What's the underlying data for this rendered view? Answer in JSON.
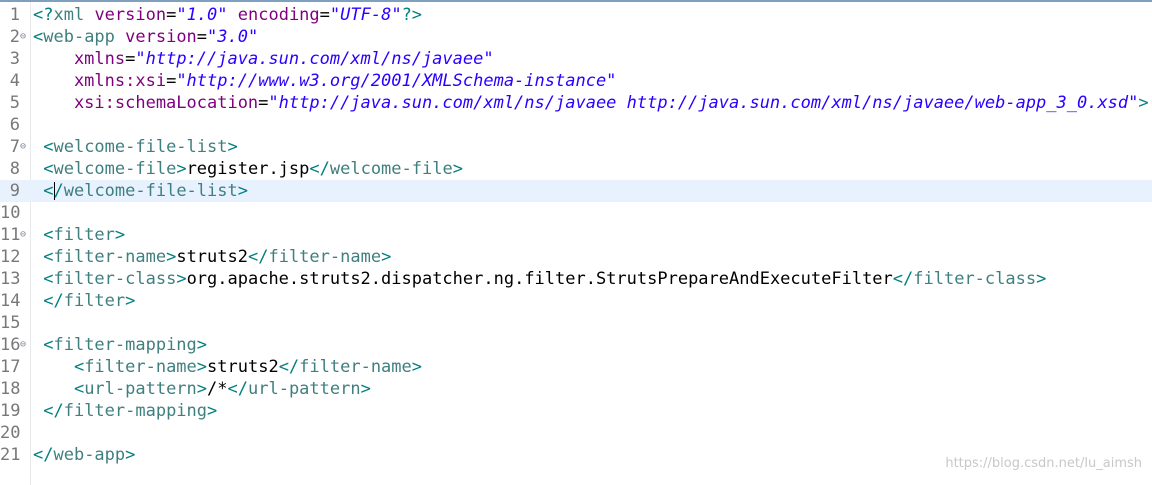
{
  "editor": {
    "lines": [
      {
        "n": "1",
        "fold": false,
        "current": false,
        "tokens": [
          {
            "t": "<?",
            "c": "decl"
          },
          {
            "t": "xml ",
            "c": "tag"
          },
          {
            "t": "version",
            "c": "attr"
          },
          {
            "t": "=",
            "c": "text"
          },
          {
            "t": "\"1.0\"",
            "c": "val"
          },
          {
            "t": " encoding",
            "c": "attr"
          },
          {
            "t": "=",
            "c": "text"
          },
          {
            "t": "\"UTF-8\"",
            "c": "val"
          },
          {
            "t": "?>",
            "c": "decl"
          }
        ]
      },
      {
        "n": "2",
        "fold": true,
        "current": false,
        "tokens": [
          {
            "t": "<",
            "c": "bracket"
          },
          {
            "t": "web-app",
            "c": "tag"
          },
          {
            "t": " version",
            "c": "attr"
          },
          {
            "t": "=",
            "c": "text"
          },
          {
            "t": "\"3.0\"",
            "c": "val"
          }
        ]
      },
      {
        "n": "3",
        "fold": false,
        "current": false,
        "tokens": [
          {
            "t": "    xmlns",
            "c": "attr"
          },
          {
            "t": "=",
            "c": "text"
          },
          {
            "t": "\"http://java.sun.com/xml/ns/javaee\"",
            "c": "val"
          }
        ]
      },
      {
        "n": "4",
        "fold": false,
        "current": false,
        "tokens": [
          {
            "t": "    xmlns:xsi",
            "c": "attr"
          },
          {
            "t": "=",
            "c": "text"
          },
          {
            "t": "\"http://www.w3.org/2001/XMLSchema-instance\"",
            "c": "val"
          }
        ]
      },
      {
        "n": "5",
        "fold": false,
        "current": false,
        "tokens": [
          {
            "t": "    xsi:schemaLocation",
            "c": "attr"
          },
          {
            "t": "=",
            "c": "text"
          },
          {
            "t": "\"http://java.sun.com/xml/ns/javaee http://java.sun.com/xml/ns/javaee/web-app_3_0.xsd\"",
            "c": "val"
          },
          {
            "t": ">",
            "c": "bracket"
          }
        ]
      },
      {
        "n": "6",
        "fold": false,
        "current": false,
        "tokens": []
      },
      {
        "n": "7",
        "fold": true,
        "current": false,
        "tokens": [
          {
            "t": " <",
            "c": "bracket"
          },
          {
            "t": "welcome-file-list",
            "c": "tag"
          },
          {
            "t": ">",
            "c": "bracket"
          }
        ]
      },
      {
        "n": "8",
        "fold": false,
        "current": false,
        "tokens": [
          {
            "t": " <",
            "c": "bracket"
          },
          {
            "t": "welcome-file",
            "c": "tag"
          },
          {
            "t": ">",
            "c": "bracket"
          },
          {
            "t": "register.jsp",
            "c": "text"
          },
          {
            "t": "</",
            "c": "bracket"
          },
          {
            "t": "welcome-file",
            "c": "tag"
          },
          {
            "t": ">",
            "c": "bracket"
          }
        ]
      },
      {
        "n": "9",
        "fold": false,
        "current": true,
        "tokens": [
          {
            "t": " <",
            "c": "bracket"
          },
          {
            "t": "CARET",
            "c": "caret"
          },
          {
            "t": "/",
            "c": "bracket"
          },
          {
            "t": "welcome-file-list",
            "c": "tag"
          },
          {
            "t": ">",
            "c": "bracket"
          }
        ]
      },
      {
        "n": "10",
        "fold": false,
        "current": false,
        "tokens": []
      },
      {
        "n": "11",
        "fold": true,
        "current": false,
        "tokens": [
          {
            "t": " <",
            "c": "bracket"
          },
          {
            "t": "filter",
            "c": "tag"
          },
          {
            "t": ">",
            "c": "bracket"
          }
        ]
      },
      {
        "n": "12",
        "fold": false,
        "current": false,
        "tokens": [
          {
            "t": " <",
            "c": "bracket"
          },
          {
            "t": "filter-name",
            "c": "tag"
          },
          {
            "t": ">",
            "c": "bracket"
          },
          {
            "t": "struts2",
            "c": "text"
          },
          {
            "t": "</",
            "c": "bracket"
          },
          {
            "t": "filter-name",
            "c": "tag"
          },
          {
            "t": ">",
            "c": "bracket"
          }
        ]
      },
      {
        "n": "13",
        "fold": false,
        "current": false,
        "tokens": [
          {
            "t": " <",
            "c": "bracket"
          },
          {
            "t": "filter-class",
            "c": "tag"
          },
          {
            "t": ">",
            "c": "bracket"
          },
          {
            "t": "org.apache.struts2.dispatcher.ng.filter.StrutsPrepareAndExecuteFilter",
            "c": "text"
          },
          {
            "t": "</",
            "c": "bracket"
          },
          {
            "t": "filter-class",
            "c": "tag"
          },
          {
            "t": ">",
            "c": "bracket"
          }
        ]
      },
      {
        "n": "14",
        "fold": false,
        "current": false,
        "tokens": [
          {
            "t": " </",
            "c": "bracket"
          },
          {
            "t": "filter",
            "c": "tag"
          },
          {
            "t": ">",
            "c": "bracket"
          }
        ]
      },
      {
        "n": "15",
        "fold": false,
        "current": false,
        "tokens": []
      },
      {
        "n": "16",
        "fold": true,
        "current": false,
        "tokens": [
          {
            "t": " <",
            "c": "bracket"
          },
          {
            "t": "filter-mapping",
            "c": "tag"
          },
          {
            "t": ">",
            "c": "bracket"
          }
        ]
      },
      {
        "n": "17",
        "fold": false,
        "current": false,
        "tokens": [
          {
            "t": "    <",
            "c": "bracket"
          },
          {
            "t": "filter-name",
            "c": "tag"
          },
          {
            "t": ">",
            "c": "bracket"
          },
          {
            "t": "struts2",
            "c": "text"
          },
          {
            "t": "</",
            "c": "bracket"
          },
          {
            "t": "filter-name",
            "c": "tag"
          },
          {
            "t": ">",
            "c": "bracket"
          }
        ]
      },
      {
        "n": "18",
        "fold": false,
        "current": false,
        "tokens": [
          {
            "t": "    <",
            "c": "bracket"
          },
          {
            "t": "url-pattern",
            "c": "tag"
          },
          {
            "t": ">",
            "c": "bracket"
          },
          {
            "t": "/*",
            "c": "text"
          },
          {
            "t": "</",
            "c": "bracket"
          },
          {
            "t": "url-pattern",
            "c": "tag"
          },
          {
            "t": ">",
            "c": "bracket"
          }
        ]
      },
      {
        "n": "19",
        "fold": false,
        "current": false,
        "tokens": [
          {
            "t": " </",
            "c": "bracket"
          },
          {
            "t": "filter-mapping",
            "c": "tag"
          },
          {
            "t": ">",
            "c": "bracket"
          }
        ]
      },
      {
        "n": "20",
        "fold": false,
        "current": false,
        "tokens": []
      },
      {
        "n": "21",
        "fold": false,
        "current": false,
        "tokens": [
          {
            "t": "</",
            "c": "bracket"
          },
          {
            "t": "web-app",
            "c": "tag"
          },
          {
            "t": ">",
            "c": "bracket"
          }
        ]
      }
    ],
    "fold_glyph": "⊖"
  },
  "watermark": "https://blog.csdn.net/lu_aimsh",
  "colors": {
    "bracket": "#008080",
    "tag": "#3f7f7f",
    "attribute": "#7f007f",
    "value": "#2a00ff",
    "text": "#000000",
    "current_line": "#e8f2fe"
  }
}
